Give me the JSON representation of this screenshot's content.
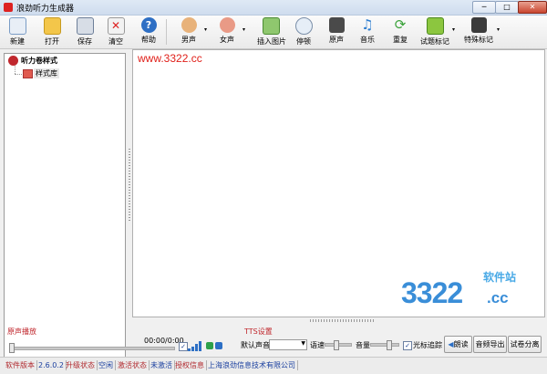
{
  "window": {
    "title": "浪劲听力生成器",
    "minimize": "─",
    "maximize": "□",
    "close": "✕"
  },
  "toolbar": {
    "new": "新建",
    "open": "打开",
    "save": "保存",
    "clear": "清空",
    "help": "帮助",
    "male": "男声",
    "female": "女声",
    "insert_image": "插入图片",
    "pause": "停顿",
    "original": "原声",
    "music": "音乐",
    "repeat": "重复",
    "question_mark": "试题标记",
    "special_mark": "特殊标记",
    "dropdown": "▾"
  },
  "tree": {
    "root": "听力卷样式",
    "child": "样式库"
  },
  "editor": {
    "watermark": "www.3322.cc"
  },
  "brand": {
    "number": "3322",
    "suffix": ".cc",
    "site": "软件站"
  },
  "playback": {
    "section": "原声播放",
    "time": "00:00/0:00"
  },
  "tts": {
    "section": "TTS设置",
    "default_voice": "默认声音",
    "voice_value": "",
    "speed": "语速",
    "volume": "音量",
    "show_marks": "光标追踪",
    "read_button": "朗读",
    "export_button": "音频导出",
    "split_button": "试卷分离"
  },
  "statusbar": {
    "version_label": "软件版本",
    "version": "2.6.0.2",
    "upgrade_label": "升级状态",
    "upgrade_value": "空闲",
    "activation_label": "激活状态",
    "activation_value": "未激活",
    "license_label": "授权信息",
    "company": "上海浪劲信息技术有限公司"
  },
  "colors": {
    "accent_red": "#c0272d",
    "brand_blue": "#3a8ed8"
  }
}
